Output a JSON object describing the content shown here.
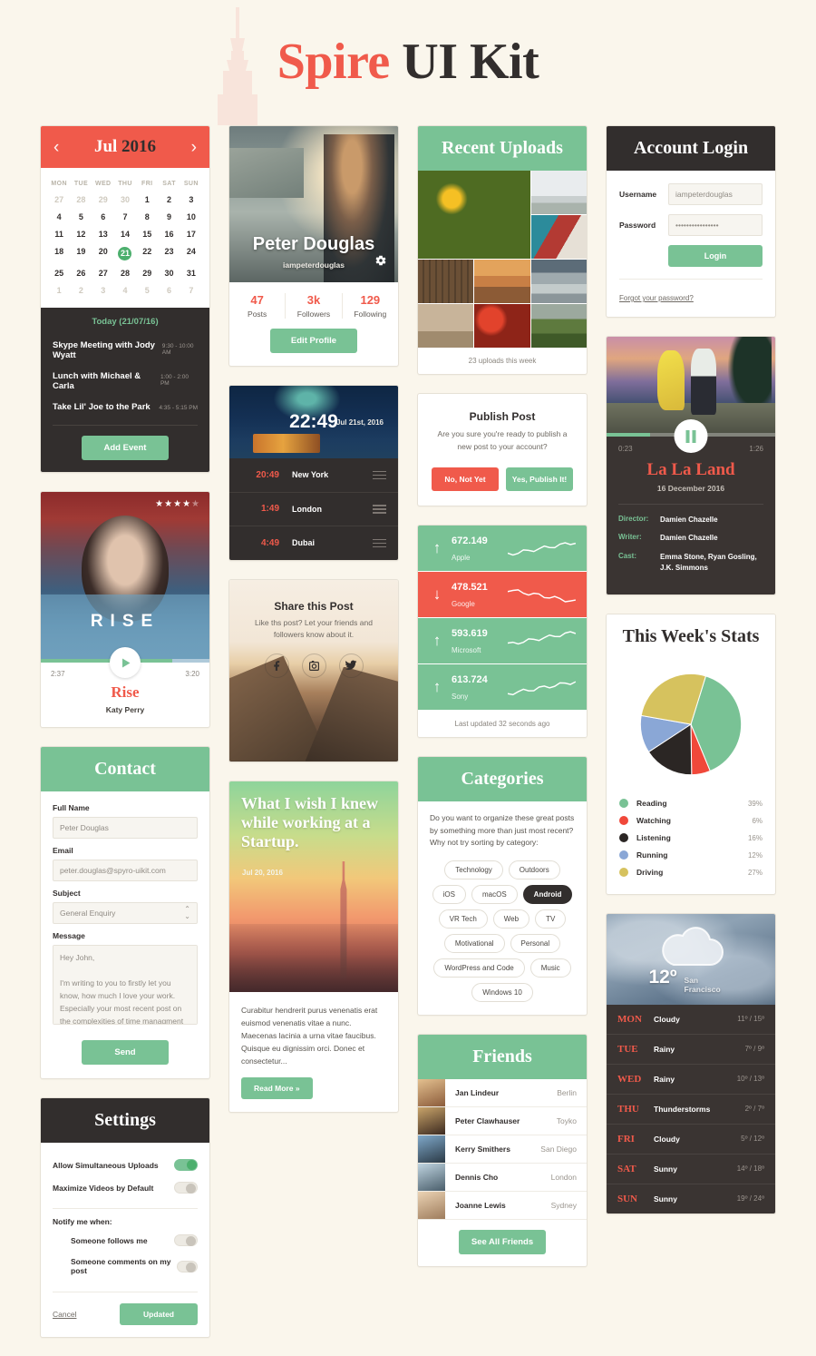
{
  "page": {
    "title_accent": "Spire",
    "title_rest": " UI Kit"
  },
  "colors": {
    "coral": "#F05A4B",
    "green": "#79C295",
    "dark": "#322E2D",
    "cream": "#FAF6EC"
  },
  "calendar": {
    "prev_icon": "chevron-left-icon",
    "next_icon": "chevron-right-icon",
    "month": "Jul",
    "year": "2016",
    "dow": [
      "MON",
      "TUE",
      "WED",
      "THU",
      "FRI",
      "SAT",
      "SUN"
    ],
    "weeks": [
      [
        {
          "d": "27",
          "mute": true
        },
        {
          "d": "28",
          "mute": true
        },
        {
          "d": "29",
          "mute": true
        },
        {
          "d": "30",
          "mute": true
        },
        {
          "d": "1"
        },
        {
          "d": "2"
        },
        {
          "d": "3"
        }
      ],
      [
        {
          "d": "4"
        },
        {
          "d": "5"
        },
        {
          "d": "6"
        },
        {
          "d": "7"
        },
        {
          "d": "8"
        },
        {
          "d": "9"
        },
        {
          "d": "10"
        }
      ],
      [
        {
          "d": "11"
        },
        {
          "d": "12"
        },
        {
          "d": "13"
        },
        {
          "d": "14"
        },
        {
          "d": "15"
        },
        {
          "d": "16"
        },
        {
          "d": "17"
        }
      ],
      [
        {
          "d": "18"
        },
        {
          "d": "19"
        },
        {
          "d": "20"
        },
        {
          "d": "21",
          "today": true
        },
        {
          "d": "22"
        },
        {
          "d": "23"
        },
        {
          "d": "24"
        }
      ],
      [
        {
          "d": "25"
        },
        {
          "d": "26"
        },
        {
          "d": "27"
        },
        {
          "d": "28"
        },
        {
          "d": "29"
        },
        {
          "d": "30"
        },
        {
          "d": "31"
        }
      ],
      [
        {
          "d": "1",
          "mute": true
        },
        {
          "d": "2",
          "mute": true
        },
        {
          "d": "3",
          "mute": true
        },
        {
          "d": "4",
          "mute": true
        },
        {
          "d": "5",
          "mute": true
        },
        {
          "d": "6",
          "mute": true
        },
        {
          "d": "7",
          "mute": true
        }
      ]
    ],
    "today_label": "Today (21/07/16)",
    "events": [
      {
        "name": "Skype Meeting with Jody Wyatt",
        "time": "9:30 - 10:00 AM"
      },
      {
        "name": "Lunch with Michael & Carla",
        "time": "1:00 - 2:00 PM"
      },
      {
        "name": "Take Lil' Joe to the Park",
        "time": "4:35 - 5:15 PM"
      }
    ],
    "add_event": "Add Event"
  },
  "profile": {
    "name": "Peter Douglas",
    "handle": "iampeterdouglas",
    "gear_icon": "gear-icon",
    "stats": [
      {
        "value": "47",
        "label": "Posts"
      },
      {
        "value": "3k",
        "label": "Followers"
      },
      {
        "value": "129",
        "label": "Following"
      }
    ],
    "edit_button": "Edit Profile"
  },
  "clock": {
    "time": "22:49",
    "date": "Jul 21st, 2016",
    "zones": [
      {
        "time": "20:49",
        "city": "New York"
      },
      {
        "time": "1:49",
        "city": "London"
      },
      {
        "time": "4:49",
        "city": "Dubai"
      }
    ]
  },
  "share": {
    "title": "Share this Post",
    "subtitle": "Like ths post? Let your friends and followers know about it.",
    "icons": [
      "facebook-icon",
      "instagram-icon",
      "twitter-icon"
    ]
  },
  "blog": {
    "title": "What I wish I knew while working at a Startup.",
    "date": "Jul 20, 2016",
    "excerpt": "Curabitur hendrerit purus venenatis erat euismod venenatis vitae a nunc. Maecenas lacinia a urna vitae faucibus. Quisque eu dignissim orci. Donec et consectetur...",
    "read_more": "Read More »"
  },
  "music": {
    "stars_filled": 4,
    "stars_total": 5,
    "cover_text": "RISE",
    "elapsed": "2:37",
    "duration": "3:20",
    "progress_percent": 78,
    "play_icon": "play-icon",
    "title": "Rise",
    "artist": "Katy Perry"
  },
  "contact": {
    "header": "Contact",
    "fields": [
      {
        "label": "Full Name",
        "value": "Peter Douglas",
        "type": "text"
      },
      {
        "label": "Email",
        "value": "peter.douglas@spyro-uikit.com",
        "type": "text"
      },
      {
        "label": "Subject",
        "value": "General Enquiry",
        "type": "select"
      }
    ],
    "message_label": "Message",
    "message_value": "Hey John,\n\nI'm writing to you to firstly let you know, how much I love your work. Especially your most recent post on the complexities of time managment software design...",
    "send_button": "Send"
  },
  "settings": {
    "header": "Settings",
    "toggles": [
      {
        "label": "Allow Simultaneous Uploads",
        "on": true
      },
      {
        "label": "Maximize Videos by Default",
        "on": false
      }
    ],
    "notify_label": "Notify me when:",
    "notify_toggles": [
      {
        "label": "Someone follows me",
        "on": false
      },
      {
        "label": "Someone comments on my post",
        "on": false
      }
    ],
    "cancel": "Cancel",
    "update": "Updated"
  },
  "uploads": {
    "header": "Recent Uploads",
    "footer": "23 uploads this week",
    "tiles": [
      "sunflowers",
      "person-jumping",
      "hand-on-book",
      "wooden-fence",
      "desert-sunset",
      "coastal-beach",
      "art-gallery",
      "red-apples",
      "castle-ruin"
    ]
  },
  "publish": {
    "title": "Publish Post",
    "subtitle": "Are you sure you're ready to publish a new post to your account?",
    "no_button": "No, Not Yet",
    "yes_button": "Yes, Publish It!"
  },
  "stocks": {
    "rows": [
      {
        "value": "672.149",
        "name": "Apple",
        "dir": "up"
      },
      {
        "value": "478.521",
        "name": "Google",
        "dir": "down"
      },
      {
        "value": "593.619",
        "name": "Microsoft",
        "dir": "up"
      },
      {
        "value": "613.724",
        "name": "Sony",
        "dir": "up"
      }
    ],
    "footer": "Last updated 32 seconds ago"
  },
  "categories": {
    "header": "Categories",
    "intro": "Do you want to organize these great posts by something more than just most recent? Why not try sorting by category:",
    "tags": [
      {
        "label": "Technology"
      },
      {
        "label": "Outdoors"
      },
      {
        "label": "iOS"
      },
      {
        "label": "macOS"
      },
      {
        "label": "Android",
        "active": true
      },
      {
        "label": "VR Tech"
      },
      {
        "label": "Web"
      },
      {
        "label": "TV"
      },
      {
        "label": "Motivational"
      },
      {
        "label": "Personal"
      },
      {
        "label": "WordPress and Code"
      },
      {
        "label": "Music"
      },
      {
        "label": "Windows 10"
      }
    ]
  },
  "friends": {
    "header": "Friends",
    "list": [
      {
        "name": "Jan Lindeur",
        "city": "Berlin"
      },
      {
        "name": "Peter Clawhauser",
        "city": "Toyko"
      },
      {
        "name": "Kerry Smithers",
        "city": "San Diego"
      },
      {
        "name": "Dennis Cho",
        "city": "London"
      },
      {
        "name": "Joanne Lewis",
        "city": "Sydney"
      }
    ],
    "see_all": "See All Friends"
  },
  "login": {
    "header": "Account Login",
    "username_label": "Username",
    "username_value": "iampeterdouglas",
    "password_label": "Password",
    "password_value": "••••••••••••••••",
    "login_button": "Login",
    "forgot": "Forgot your password?"
  },
  "movie": {
    "elapsed": "0:23",
    "duration": "1:26",
    "pause_icon": "pause-icon",
    "title": "La La Land",
    "date": "16 December 2016",
    "meta": [
      {
        "key": "Director:",
        "value": "Damien Chazelle"
      },
      {
        "key": "Writer:",
        "value": "Damien Chazelle"
      },
      {
        "key": "Cast:",
        "value": "Emma Stone, Ryan Gosling, J.K. Simmons"
      }
    ]
  },
  "weather": {
    "cloud_icon": "cloud-icon",
    "temp": "12º",
    "city": "San Francisco",
    "days": [
      {
        "day": "MON",
        "cond": "Cloudy",
        "temps": "11º / 15º"
      },
      {
        "day": "TUE",
        "cond": "Rainy",
        "temps": "7º / 9º"
      },
      {
        "day": "WED",
        "cond": "Rainy",
        "temps": "10º / 13º"
      },
      {
        "day": "THU",
        "cond": "Thunderstorms",
        "temps": "2º / 7º"
      },
      {
        "day": "FRI",
        "cond": "Cloudy",
        "temps": "5º / 12º"
      },
      {
        "day": "SAT",
        "cond": "Sunny",
        "temps": "14º / 18º"
      },
      {
        "day": "SUN",
        "cond": "Sunny",
        "temps": "19º / 24º"
      }
    ]
  },
  "chart_data": {
    "type": "pie",
    "title": "This Week's Stats",
    "categories": [
      "Reading",
      "Watching",
      "Listening",
      "Running",
      "Driving"
    ],
    "values": [
      39,
      6,
      16,
      12,
      27
    ],
    "labels": [
      "39%",
      "6%",
      "16%",
      "12%",
      "27%"
    ],
    "colors": [
      "#79C295",
      "#F0483A",
      "#2B2624",
      "#8AA7D6",
      "#D6C25E"
    ],
    "legend": "below",
    "unit": "%"
  }
}
